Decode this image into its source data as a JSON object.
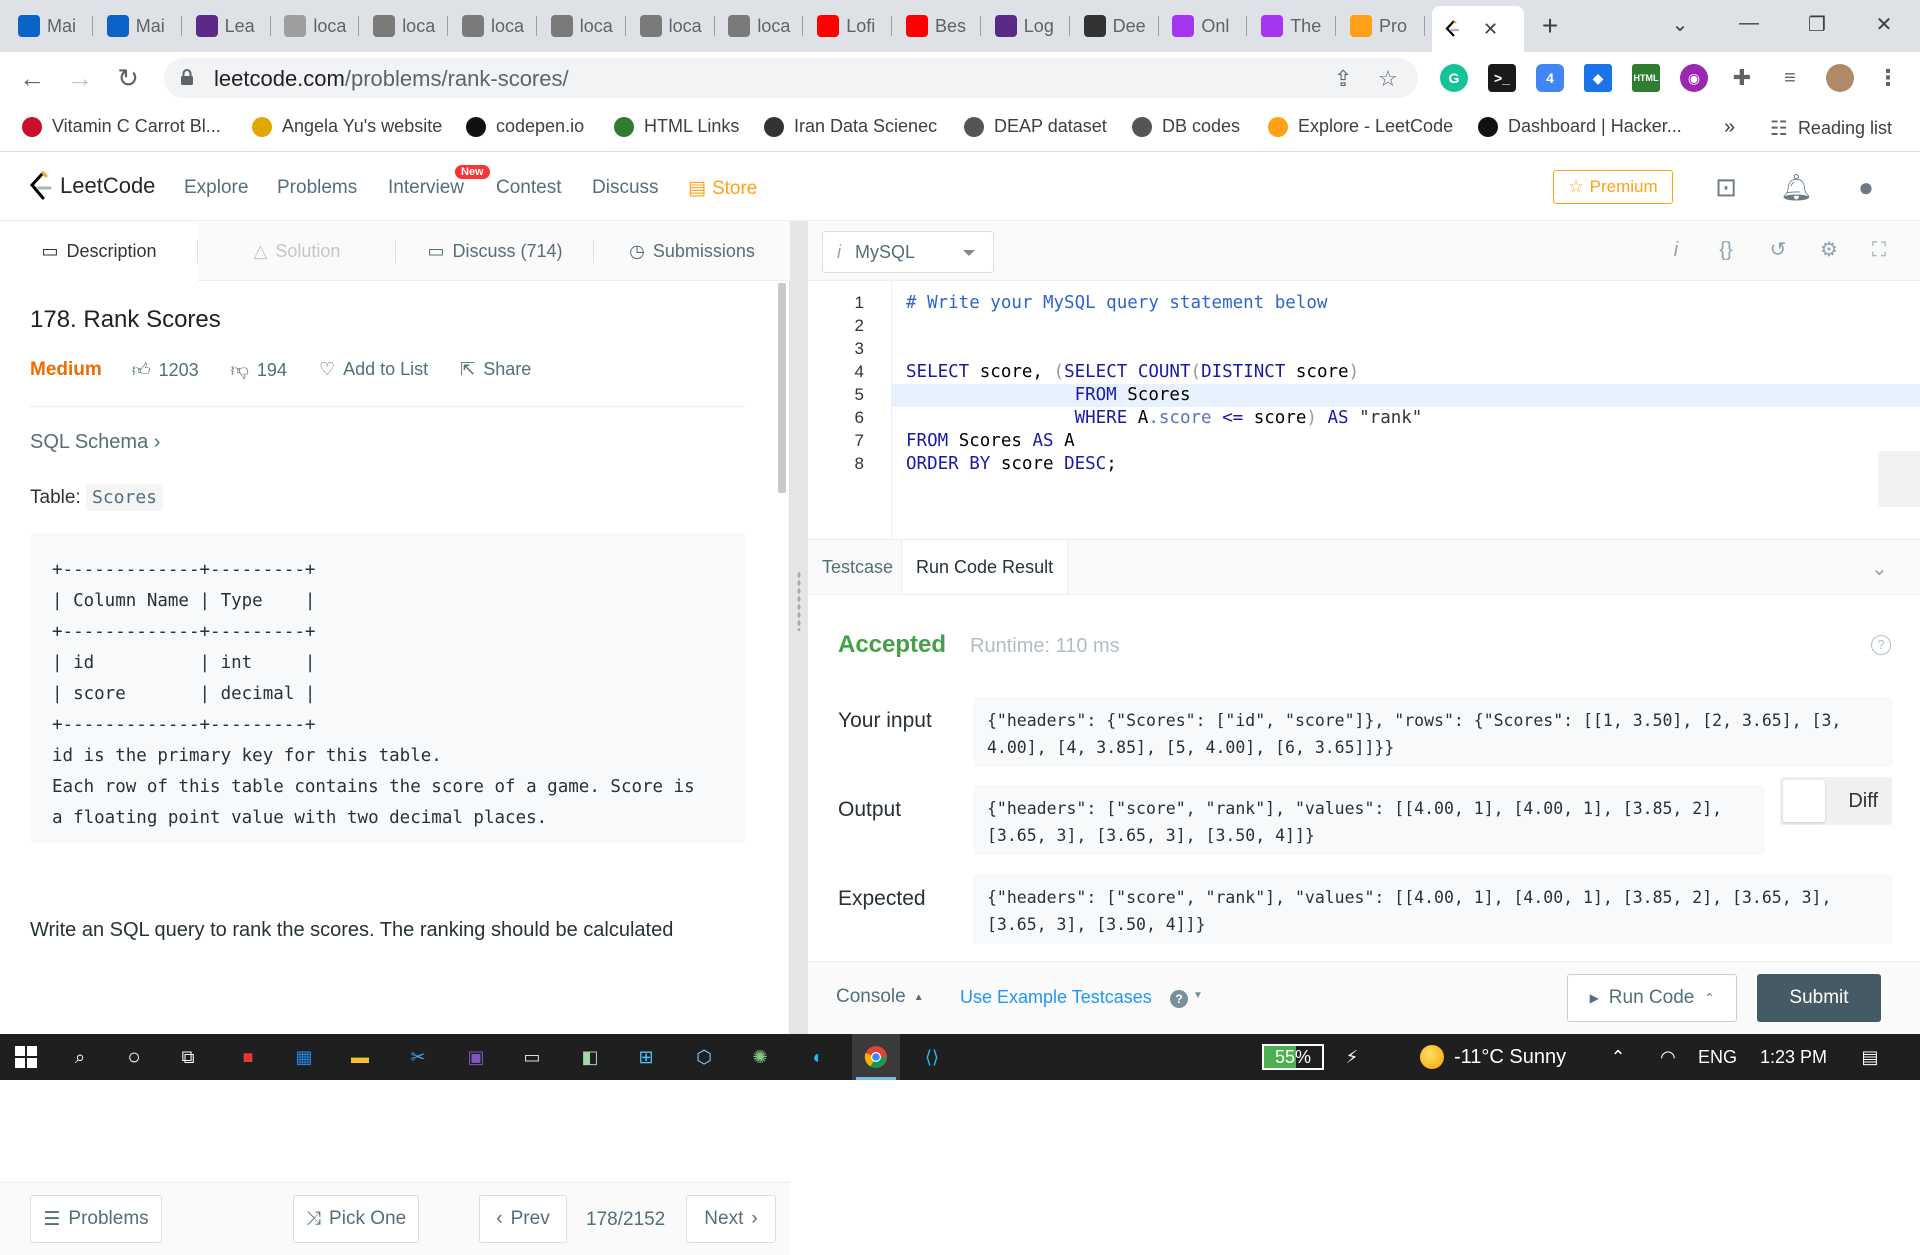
{
  "browser": {
    "tabs": [
      {
        "label": "Mai",
        "icon": "outlook-icon",
        "color": "#0a64c8"
      },
      {
        "label": "Mai",
        "icon": "outlook-icon",
        "color": "#0a64c8"
      },
      {
        "label": "Lea",
        "icon": "shield-icon",
        "color": "#5b2a86"
      },
      {
        "label": "loca",
        "icon": "loading-icon",
        "color": "#9e9e9e"
      },
      {
        "label": "loca",
        "icon": "page-icon",
        "color": "#7a7a7a"
      },
      {
        "label": "loca",
        "icon": "page-icon",
        "color": "#7a7a7a"
      },
      {
        "label": "loca",
        "icon": "page-icon",
        "color": "#7a7a7a"
      },
      {
        "label": "loca",
        "icon": "page-icon",
        "color": "#7a7a7a"
      },
      {
        "label": "loca",
        "icon": "page-icon",
        "color": "#7a7a7a"
      },
      {
        "label": "Lofi",
        "icon": "youtube-icon",
        "color": "#ff0000"
      },
      {
        "label": "Bes",
        "icon": "youtube-icon",
        "color": "#ff0000"
      },
      {
        "label": "Log",
        "icon": "shield-icon",
        "color": "#5b2a86"
      },
      {
        "label": "Dee",
        "icon": "wikipedia-icon",
        "color": "#333333"
      },
      {
        "label": "Onl",
        "icon": "udemy-icon",
        "color": "#a435f0"
      },
      {
        "label": "The",
        "icon": "udemy-icon",
        "color": "#a435f0"
      },
      {
        "label": "Pro",
        "icon": "leetcode-icon",
        "color": "#ffa116"
      }
    ],
    "active_tab_close": "✕",
    "new_tab": "+",
    "url_host": "leetcode.com",
    "url_path": "/problems/rank-scores/",
    "bookmarks": [
      {
        "label": "Vitamin C Carrot Bl...",
        "color": "#c8102e"
      },
      {
        "label": "Angela Yu's website",
        "color": "#e0a800"
      },
      {
        "label": "codepen.io",
        "color": "#111111"
      },
      {
        "label": "HTML Links",
        "color": "#2e7d32"
      },
      {
        "label": "Iran Data Scienec",
        "color": "#333333"
      },
      {
        "label": "DEAP dataset",
        "color": "#555555"
      },
      {
        "label": "DB codes",
        "color": "#555555"
      },
      {
        "label": "Explore - LeetCode",
        "color": "#ffa116"
      },
      {
        "label": "Dashboard | Hacker...",
        "color": "#111111"
      }
    ],
    "bookmarks_more": "»",
    "reading_list": "Reading list"
  },
  "lc_nav": {
    "logo": "LeetCode",
    "links": [
      "Explore",
      "Problems",
      "Interview",
      "Contest",
      "Discuss"
    ],
    "new_badge": "New",
    "store": "Store",
    "premium": "Premium",
    "accent": "#ffa116"
  },
  "left": {
    "tabs": [
      "Description",
      "Solution",
      "Discuss (714)",
      "Submissions"
    ],
    "title": "178. Rank Scores",
    "difficulty": "Medium",
    "likes": "1203",
    "dislikes": "194",
    "add_to_list": "Add to List",
    "share": "Share",
    "sql_schema": "SQL Schema ›",
    "table_label": "Table:",
    "table_name": "Scores",
    "schema_text": "+-------------+---------+\n| Column Name | Type    |\n+-------------+---------+\n| id          | int     |\n| score       | decimal |\n+-------------+---------+\nid is the primary key for this table.\nEach row of this table contains the score of a game. Score is\na floating point value with two decimal places.",
    "description": "Write an SQL query to rank the scores. The ranking should be calculated",
    "footer": {
      "problems": "Problems",
      "pick_one": "Pick One",
      "prev": "Prev",
      "counter": "178/2152",
      "next": "Next"
    }
  },
  "editor": {
    "language": "MySQL",
    "line_numbers": [
      "1",
      "2",
      "3",
      "4",
      "5",
      "6",
      "7",
      "8"
    ]
  },
  "result": {
    "tabs": [
      "Testcase",
      "Run Code Result"
    ],
    "status": "Accepted",
    "runtime": "Runtime: 110 ms",
    "input_label": "Your input",
    "input_value": "{\"headers\": {\"Scores\": [\"id\", \"score\"]}, \"rows\": {\"Scores\": [[1, 3.50], [2, 3.65], [3, 4.00], [4, 3.85], [5, 4.00], [6, 3.65]]}}",
    "output_label": "Output",
    "output_value": "{\"headers\": [\"score\", \"rank\"], \"values\": [[4.00, 1], [4.00, 1], [3.85, 2], [3.65, 3], [3.65, 3], [3.50, 4]]}",
    "expected_label": "Expected",
    "expected_value": "{\"headers\": [\"score\", \"rank\"], \"values\": [[4.00, 1], [4.00, 1], [3.85, 2], [3.65, 3], [3.65, 3], [3.50, 4]]}",
    "diff": "Diff",
    "success_color": "#43a047"
  },
  "footer": {
    "console": "Console",
    "use_example": "Use Example Testcases",
    "run_code": "Run Code",
    "submit": "Submit"
  },
  "taskbar": {
    "battery": "55%",
    "battery_level": 0.55,
    "weather": "-11°C  Sunny",
    "lang": "ENG",
    "time": "1:23 PM"
  }
}
